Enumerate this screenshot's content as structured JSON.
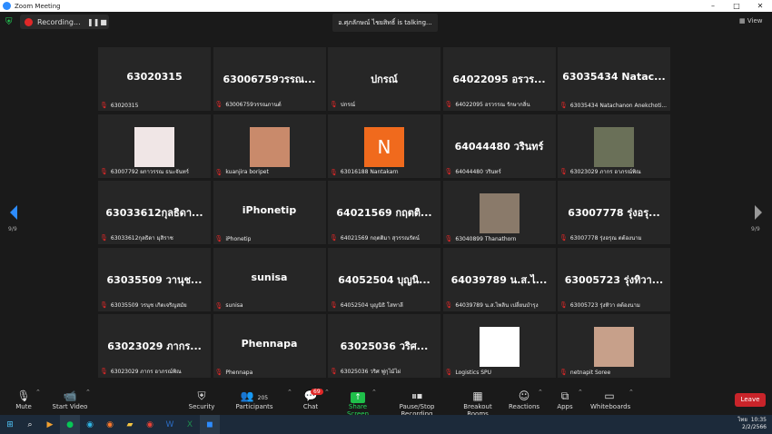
{
  "window": {
    "title": "Zoom Meeting"
  },
  "topbar": {
    "recording_label": "Recording...",
    "talking": "อ.ศุภลักษณ์ ไชยสิทธิ์ is talking...",
    "view_label": "View"
  },
  "navigation": {
    "page_left": "9/9",
    "page_right": "9/9"
  },
  "tiles": [
    {
      "display": "63020315",
      "label": "63020315",
      "type": "text"
    },
    {
      "display": "63006759วรรณ...",
      "label": "63006759วรรณภานต์",
      "type": "text"
    },
    {
      "display": "ปกรณ์",
      "label": "ปกรณ์",
      "type": "text"
    },
    {
      "display": "64022095 อรวร...",
      "label": "64022095 อรวรรณ รักษากลิ่น",
      "type": "text"
    },
    {
      "display": "63035434 Natac...",
      "label": "63035434 Natachanon Anekchoti...",
      "type": "text"
    },
    {
      "display": "",
      "label": "63007792 ผกาวรรณ ธนะจันทร์",
      "type": "photo",
      "color": "#f0e6e6"
    },
    {
      "display": "",
      "label": "kuanjira boripet",
      "type": "photo",
      "color": "#c98a6b"
    },
    {
      "display": "N",
      "label": "63016188 Nantakarn",
      "type": "avatar"
    },
    {
      "display": "64044480 วรินทร์",
      "label": "64044480 วรินทร์",
      "type": "text"
    },
    {
      "display": "",
      "label": "63023029 ภากร อาภรณ์พิณ",
      "type": "photo",
      "color": "#6a7058"
    },
    {
      "display": "63033612กุลธิดา...",
      "label": "63033612กุลธิดา มุสิราช",
      "type": "text"
    },
    {
      "display": "iPhonetip",
      "label": "iPhonetip",
      "type": "text"
    },
    {
      "display": "64021569 กฤตติ...",
      "label": "64021569 กฤตติมา สุวรรณรัตน์",
      "type": "text"
    },
    {
      "display": "",
      "label": "63040899 Thanathorn",
      "type": "photo",
      "color": "#8a7a6a"
    },
    {
      "display": "63007778 รุ่งอรุ...",
      "label": "63007778 รุ่งอรุณ ตต้องนาม",
      "type": "text"
    },
    {
      "display": "63035509 วานุช...",
      "label": "63035509 วรนุช เกิดเจริญสมัย",
      "type": "text"
    },
    {
      "display": "sunisa",
      "label": "sunisa",
      "type": "text"
    },
    {
      "display": "64052504 บุญนิ...",
      "label": "64052504 บุญนิธิ โสทาลี",
      "type": "text"
    },
    {
      "display": "64039789 น.ส.ไ...",
      "label": "64039789 น.ส.ไพลิน เปลี่ยนบำรุง",
      "type": "text"
    },
    {
      "display": "63005723 รุ่งทิวา...",
      "label": "63005723 รุ่งทิวา ตต้องนาม",
      "type": "text"
    },
    {
      "display": "63023029 ภากร...",
      "label": "63023029 ภากร อาภรณ์พิณ",
      "type": "text"
    },
    {
      "display": "Phennapa",
      "label": "Phennapa",
      "type": "text"
    },
    {
      "display": "63025036 วริศ...",
      "label": "63025036 วริศ ฟูกุไม้ไผ่",
      "type": "text"
    },
    {
      "display": "",
      "label": "Logistics SPU",
      "type": "photo",
      "color": "#ffffff"
    },
    {
      "display": "",
      "label": "netnapit Soree",
      "type": "photo",
      "color": "#c7a08a"
    }
  ],
  "toolbar": {
    "mute": "Mute",
    "start_video": "Start Video",
    "security": "Security",
    "participants": "Participants",
    "participants_count": "205",
    "chat": "Chat",
    "chat_badge": "69",
    "share_screen": "Share Screen",
    "pause_recording": "Pause/Stop Recording",
    "breakout": "Breakout Rooms",
    "reactions": "Reactions",
    "apps": "Apps",
    "whiteboards": "Whiteboards",
    "leave": "Leave"
  },
  "taskbar": {
    "time": "10:35",
    "date": "2/2/2566",
    "lang": "ไทย"
  }
}
